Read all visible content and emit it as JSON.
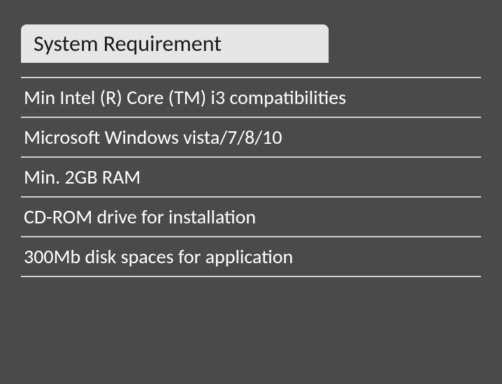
{
  "header": {
    "title": "System Requirement"
  },
  "requirements": {
    "items": [
      "Min Intel (R) Core (TM) i3 compatibilities",
      "Microsoft Windows vista/7/8/10",
      "Min. 2GB RAM",
      "CD-ROM drive for installation",
      "300Mb disk spaces for application"
    ]
  }
}
